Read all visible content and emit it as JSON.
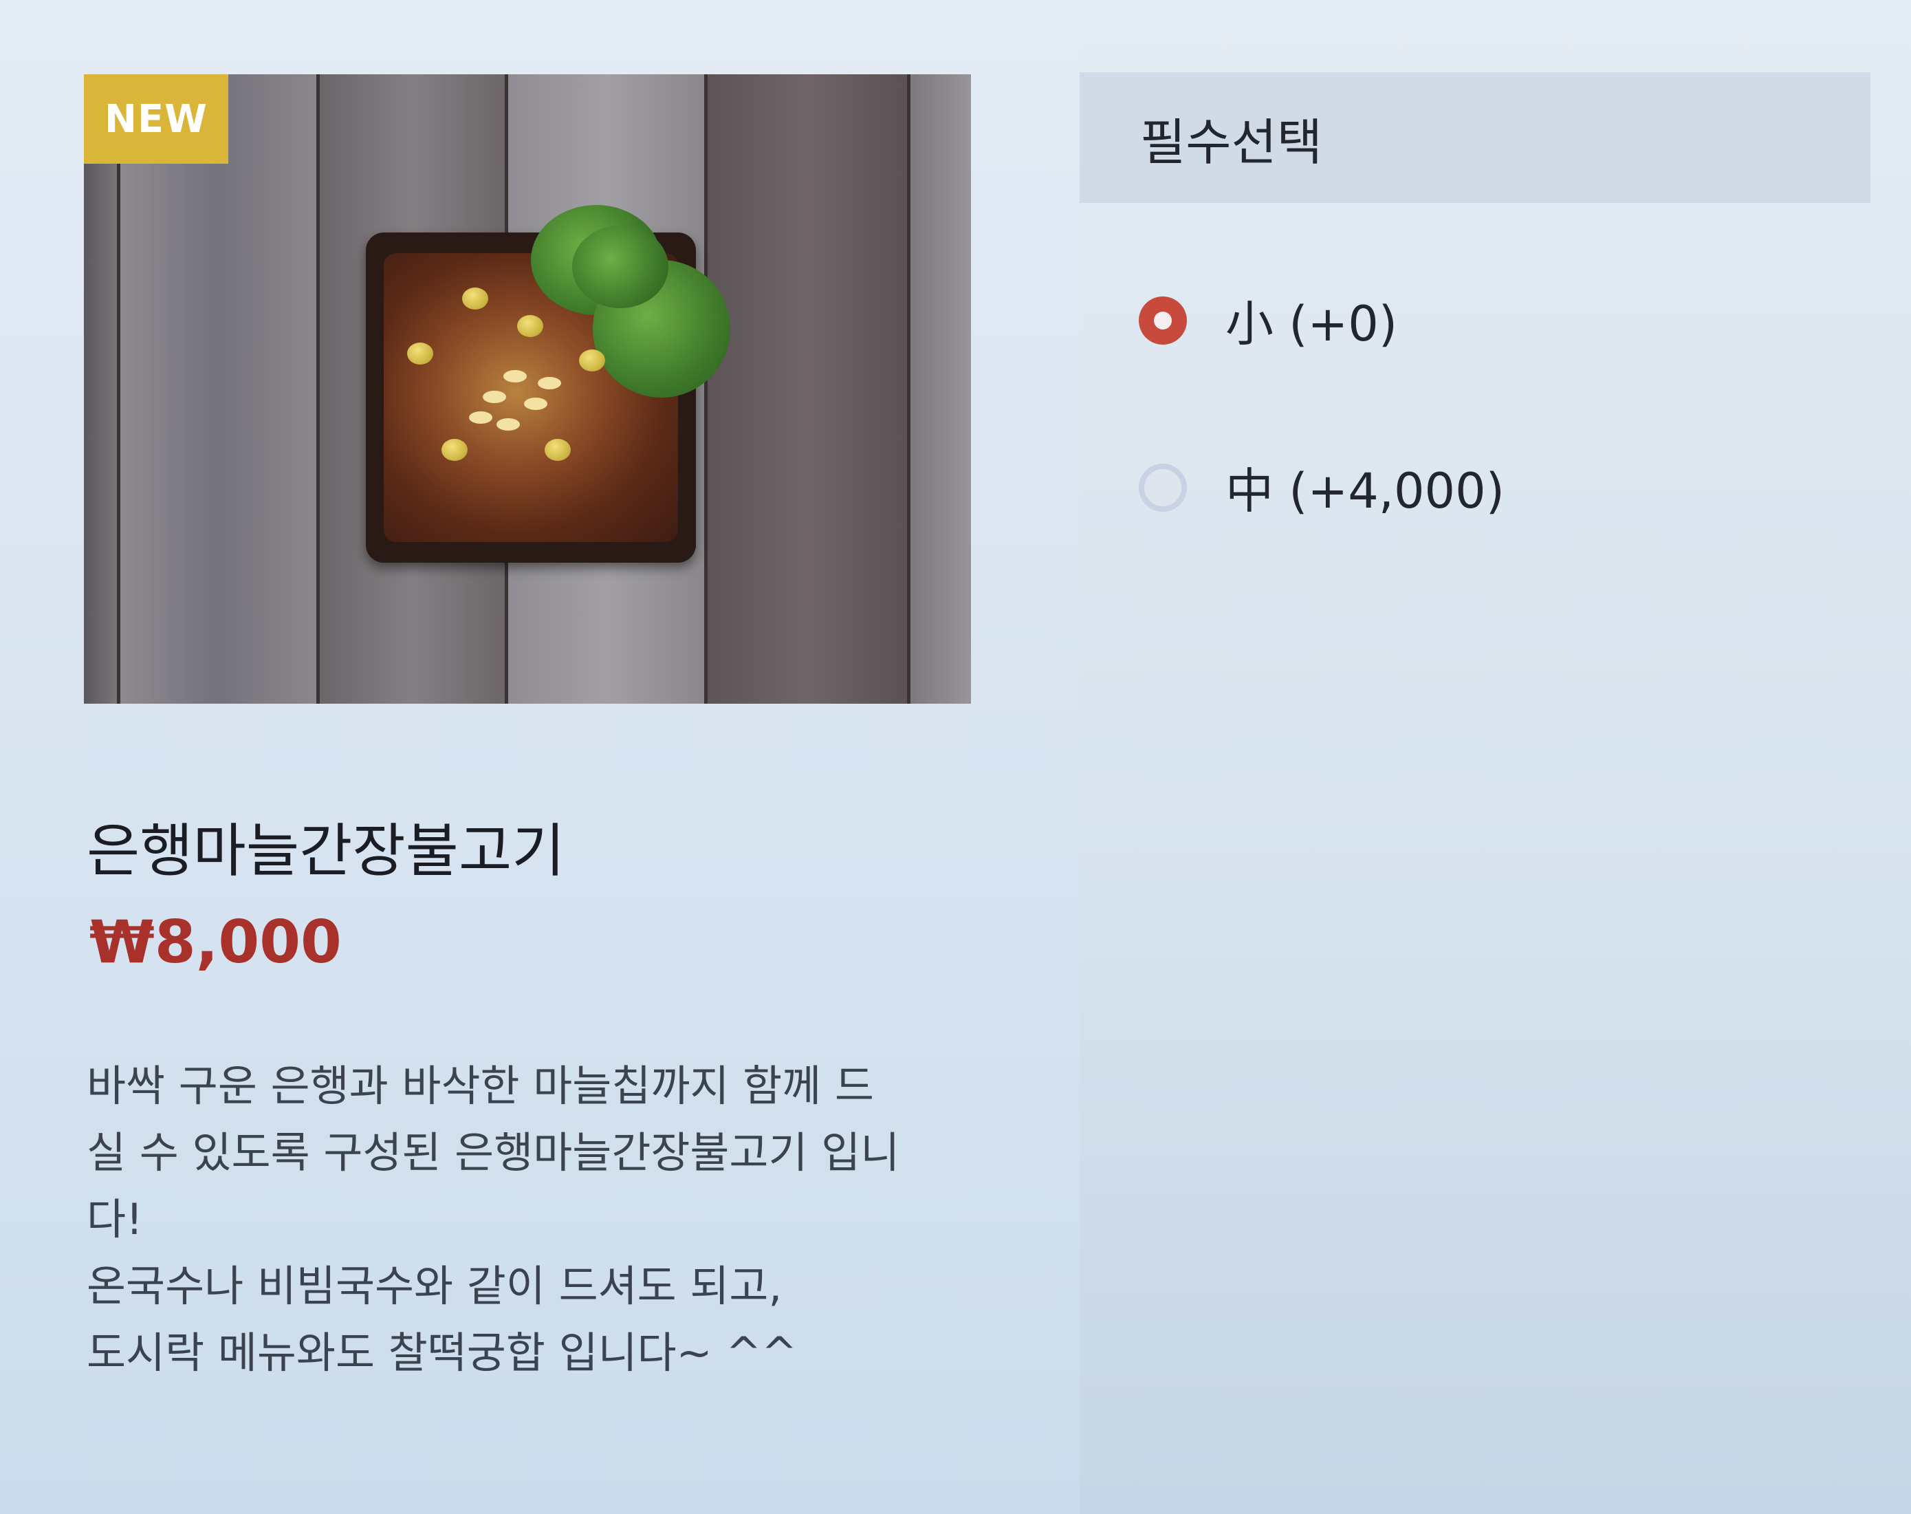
{
  "product": {
    "badge": "NEW",
    "name": "은행마늘간장불고기",
    "price": "₩8,000",
    "description_lines": [
      "바싹 구운 은행과 바삭한 마늘칩까지 함께 드",
      "실 수 있도록 구성된 은행마늘간장불고기 입니",
      "다!",
      "온국수나 비빔국수와 같이 드셔도 되고,",
      "도시락 메뉴와도 찰떡궁합 입니다~ ^^"
    ]
  },
  "options": {
    "title": "필수선택",
    "items": [
      {
        "label": "小 (+0)",
        "selected": true
      },
      {
        "label": "中 (+4,000)",
        "selected": false
      }
    ]
  },
  "colors": {
    "price": "#a8322b",
    "badge": "#d9b63a",
    "radio_selected": "#c84a3c",
    "radio_unselected": "#c9d2e4"
  }
}
